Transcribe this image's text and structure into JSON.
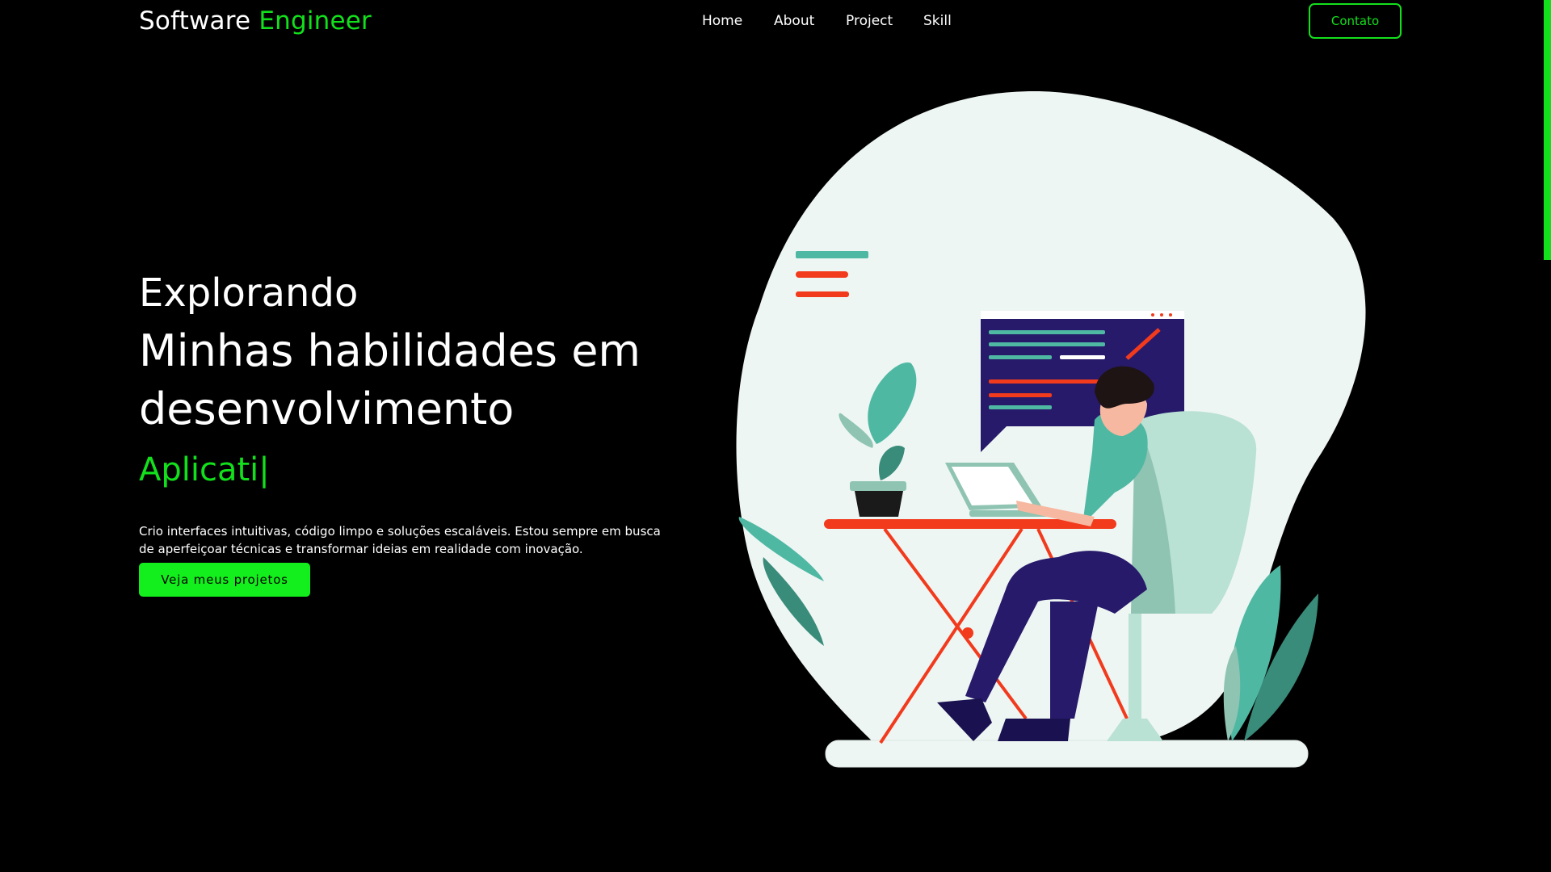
{
  "header": {
    "logo_text": "Software",
    "logo_accent": "Engineer",
    "nav": [
      "Home",
      "About",
      "Project",
      "Skill"
    ],
    "contact_label": "Contato"
  },
  "hero": {
    "line1": "Explorando",
    "line2": "Minhas habilidades em",
    "line3": "desenvolvimento",
    "typed_text": "Aplicati|",
    "description": "Crio interfaces intuitivas, código limpo e soluções escaláveis. Estou sempre em busca de aperfeiçoar técnicas e transformar ideias em realidade com inovação.",
    "cta_label": "Veja meus projetos"
  },
  "colors": {
    "background": "#000000",
    "accent": "#13e01c",
    "text": "#ffffff",
    "blob": "#eef6f3",
    "monitor": "#271a6a",
    "teal": "#4fb8a3",
    "red": "#f23a1d"
  },
  "illustration": {
    "icon": "developer-at-desk-illustration"
  }
}
